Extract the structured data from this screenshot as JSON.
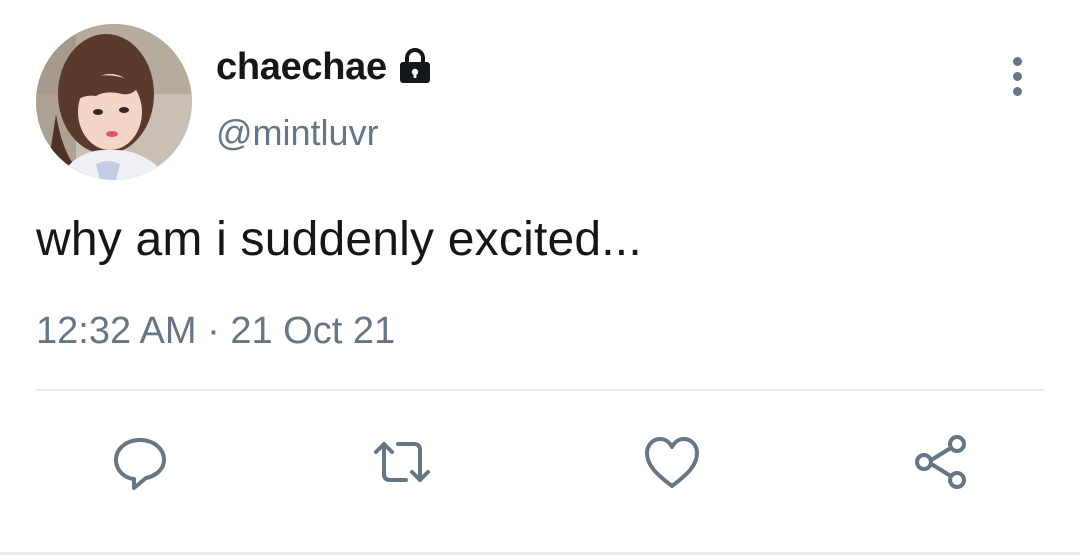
{
  "tweet": {
    "author": {
      "display_name": "chaechae",
      "handle": "@mintluvr",
      "protected_icon": "lock-icon",
      "avatar": "profile-photo"
    },
    "text": "why am i suddenly excited...",
    "time": "12:32 AM",
    "separator": "·",
    "date": "21 Oct 21"
  },
  "menu_icon": "more-vertical-icon",
  "actions": [
    {
      "icon": "reply-icon"
    },
    {
      "icon": "retweet-icon"
    },
    {
      "icon": "like-icon"
    },
    {
      "icon": "share-icon"
    }
  ],
  "colors": {
    "text_primary": "#14171a",
    "text_secondary": "#657786",
    "divider": "#e6ecf0"
  }
}
